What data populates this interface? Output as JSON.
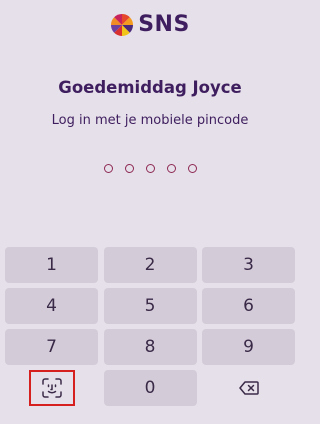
{
  "brand": {
    "name": "SNS",
    "logo_icon": "sns-logo-icon"
  },
  "greeting": "Goedemiddag Joyce",
  "instruction": "Log in met je mobiele pincode",
  "pin": {
    "length": 5,
    "entered": 0
  },
  "keypad": {
    "keys": [
      "1",
      "2",
      "3",
      "4",
      "5",
      "6",
      "7",
      "8",
      "9"
    ],
    "zero": "0",
    "biometric_icon": "face-id-icon",
    "delete_icon": "backspace-icon"
  },
  "colors": {
    "background": "#e6e0ea",
    "key": "#d3ccd8",
    "brand_text": "#3e1e5e",
    "pin_dot": "#8e2a55",
    "highlight": "#d62020"
  }
}
